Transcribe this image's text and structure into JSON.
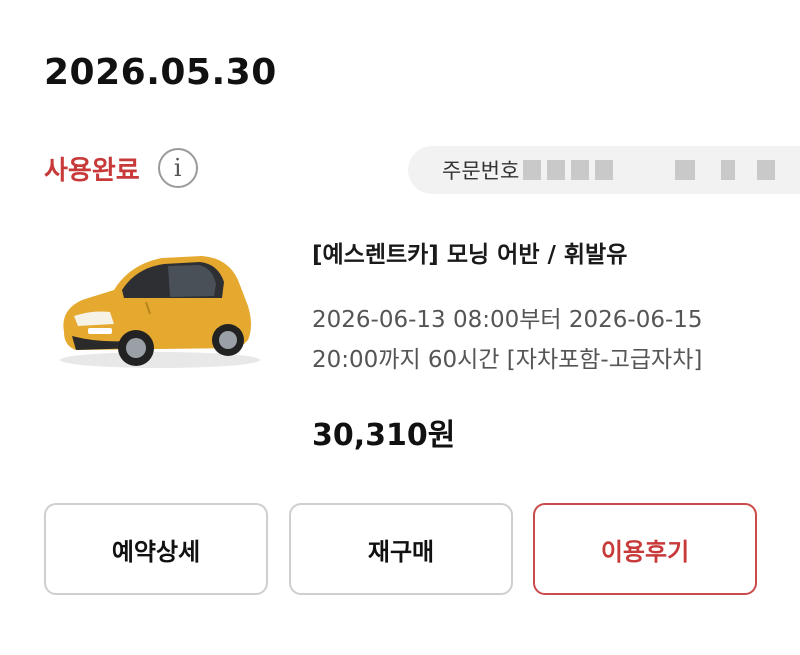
{
  "order": {
    "date": "2026.05.30",
    "status": "사용완료",
    "info_icon_glyph": "i",
    "order_number_label": "주문번호"
  },
  "product": {
    "title": "[예스렌트카] 모닝 어반 / 휘발유",
    "period_line1": "2026-06-13 08:00부터 2026-06-15",
    "period_line2": "20:00까지 60시간 [자차포함-고급자차]",
    "price": "30,310원",
    "image_icon": "yellow-hatchback-car"
  },
  "actions": {
    "detail_label": "예약상세",
    "rebuy_label": "재구매",
    "review_label": "이용후기"
  },
  "colors": {
    "status": "#c83a3a",
    "review_border": "#c94b4b",
    "car_body": "#e4a92e"
  }
}
